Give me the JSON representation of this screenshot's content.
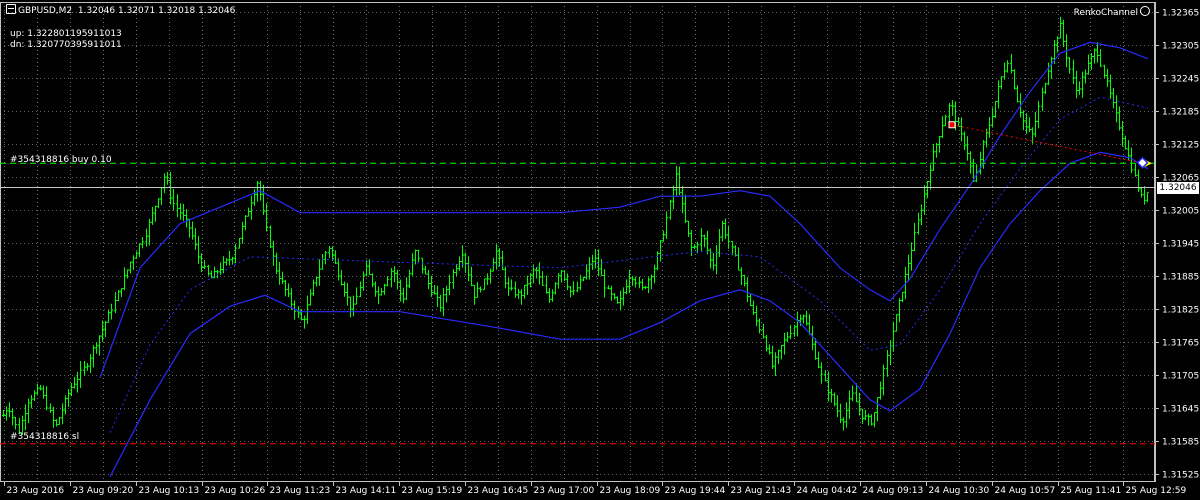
{
  "header": {
    "symbol": "GBPUSD,M2",
    "ohlc": "1.32046 1.32071 1.32018 1.32046"
  },
  "indicator": {
    "name": "RenkoChannel",
    "up_text": "up: 1.322801195911013",
    "dn_text": "dn: 1.320770395911011"
  },
  "order": {
    "label": "#354318816 buy 0.10",
    "price": 1.3209
  },
  "stop_loss": {
    "label": "#354318816 sl",
    "price": 1.3158
  },
  "current_price": {
    "label": "1.32046",
    "value": 1.32046
  },
  "colors": {
    "background": "#000000",
    "grid": "#c0c0c0",
    "bars": "#00ff00",
    "channel": "#2a2aff",
    "order_line": "#00ff00",
    "sl_line": "#ff0000",
    "axis_text": "#ffffff"
  },
  "chart_data": {
    "type": "ohlc",
    "y_ticks": [
      "1.32365",
      "1.32305",
      "1.32245",
      "1.32185",
      "1.32125",
      "1.32065",
      "1.32005",
      "1.31945",
      "1.31885",
      "1.31825",
      "1.31765",
      "1.31705",
      "1.31645",
      "1.31585",
      "1.31525"
    ],
    "ylim": [
      1.31525,
      1.32365
    ],
    "x_ticks": [
      "23 Aug 2016",
      "23 Aug 09:20",
      "23 Aug 10:13",
      "23 Aug 10:26",
      "23 Aug 11:23",
      "23 Aug 14:11",
      "23 Aug 15:19",
      "23 Aug 16:45",
      "23 Aug 17:00",
      "23 Aug 18:09",
      "23 Aug 19:44",
      "23 Aug 21:43",
      "24 Aug 04:42",
      "24 Aug 09:13",
      "24 Aug 10:30",
      "24 Aug 10:57",
      "25 Aug 11:41",
      "25 Aug 12:59"
    ],
    "grid": true,
    "price_path": [
      [
        0,
        1.3162
      ],
      [
        8,
        1.3165
      ],
      [
        18,
        1.316
      ],
      [
        28,
        1.3166
      ],
      [
        40,
        1.3168
      ],
      [
        55,
        1.3161
      ],
      [
        70,
        1.3168
      ],
      [
        85,
        1.3172
      ],
      [
        100,
        1.3178
      ],
      [
        115,
        1.3184
      ],
      [
        130,
        1.3191
      ],
      [
        145,
        1.3196
      ],
      [
        158,
        1.3203
      ],
      [
        165,
        1.3207
      ],
      [
        172,
        1.3202
      ],
      [
        180,
        1.32
      ],
      [
        190,
        1.3197
      ],
      [
        200,
        1.3191
      ],
      [
        210,
        1.3188
      ],
      [
        220,
        1.319
      ],
      [
        232,
        1.3192
      ],
      [
        245,
        1.3199
      ],
      [
        258,
        1.3206
      ],
      [
        265,
        1.3198
      ],
      [
        275,
        1.319
      ],
      [
        290,
        1.3184
      ],
      [
        302,
        1.318
      ],
      [
        315,
        1.3188
      ],
      [
        328,
        1.3194
      ],
      [
        340,
        1.3188
      ],
      [
        352,
        1.3182
      ],
      [
        365,
        1.319
      ],
      [
        378,
        1.3185
      ],
      [
        392,
        1.319
      ],
      [
        402,
        1.3184
      ],
      [
        415,
        1.3193
      ],
      [
        428,
        1.3187
      ],
      [
        440,
        1.3183
      ],
      [
        450,
        1.3188
      ],
      [
        462,
        1.3193
      ],
      [
        474,
        1.3185
      ],
      [
        486,
        1.3188
      ],
      [
        496,
        1.3193
      ],
      [
        508,
        1.3186
      ],
      [
        520,
        1.3185
      ],
      [
        535,
        1.319
      ],
      [
        548,
        1.3184
      ],
      [
        560,
        1.319
      ],
      [
        572,
        1.3185
      ],
      [
        582,
        1.3188
      ],
      [
        594,
        1.3192
      ],
      [
        606,
        1.3186
      ],
      [
        618,
        1.3183
      ],
      [
        630,
        1.3189
      ],
      [
        642,
        1.3186
      ],
      [
        654,
        1.319
      ],
      [
        664,
        1.3197
      ],
      [
        676,
        1.3207
      ],
      [
        684,
        1.3199
      ],
      [
        692,
        1.3193
      ],
      [
        702,
        1.3196
      ],
      [
        712,
        1.319
      ],
      [
        722,
        1.3198
      ],
      [
        732,
        1.3193
      ],
      [
        742,
        1.3188
      ],
      [
        752,
        1.3182
      ],
      [
        762,
        1.3178
      ],
      [
        772,
        1.3172
      ],
      [
        782,
        1.3176
      ],
      [
        792,
        1.3179
      ],
      [
        802,
        1.3182
      ],
      [
        812,
        1.3176
      ],
      [
        822,
        1.317
      ],
      [
        832,
        1.3166
      ],
      [
        842,
        1.3162
      ],
      [
        852,
        1.3167
      ],
      [
        862,
        1.3163
      ],
      [
        872,
        1.3162
      ],
      [
        882,
        1.317
      ],
      [
        892,
        1.3178
      ],
      [
        902,
        1.3186
      ],
      [
        912,
        1.3194
      ],
      [
        922,
        1.3202
      ],
      [
        932,
        1.321
      ],
      [
        942,
        1.3216
      ],
      [
        950,
        1.322
      ],
      [
        958,
        1.3215
      ],
      [
        966,
        1.3212
      ],
      [
        974,
        1.3205
      ],
      [
        982,
        1.3212
      ],
      [
        992,
        1.3218
      ],
      [
        1000,
        1.3224
      ],
      [
        1008,
        1.3228
      ],
      [
        1016,
        1.3221
      ],
      [
        1024,
        1.3216
      ],
      [
        1032,
        1.3214
      ],
      [
        1042,
        1.3222
      ],
      [
        1050,
        1.3228
      ],
      [
        1060,
        1.3234
      ],
      [
        1068,
        1.3227
      ],
      [
        1076,
        1.3222
      ],
      [
        1086,
        1.3226
      ],
      [
        1096,
        1.323
      ],
      [
        1104,
        1.3225
      ],
      [
        1112,
        1.322
      ],
      [
        1122,
        1.3214
      ],
      [
        1132,
        1.3208
      ],
      [
        1142,
        1.3202
      ],
      [
        1150,
        1.3205
      ]
    ],
    "channel_upper": [
      [
        100,
        1.317
      ],
      [
        140,
        1.319
      ],
      [
        180,
        1.3198
      ],
      [
        220,
        1.3201
      ],
      [
        260,
        1.3204
      ],
      [
        300,
        1.32
      ],
      [
        400,
        1.32
      ],
      [
        500,
        1.32
      ],
      [
        560,
        1.32
      ],
      [
        620,
        1.3201
      ],
      [
        660,
        1.3203
      ],
      [
        700,
        1.3203
      ],
      [
        740,
        1.3204
      ],
      [
        770,
        1.3203
      ],
      [
        800,
        1.3198
      ],
      [
        840,
        1.319
      ],
      [
        870,
        1.3186
      ],
      [
        890,
        1.3184
      ],
      [
        910,
        1.3188
      ],
      [
        940,
        1.3197
      ],
      [
        970,
        1.3205
      ],
      [
        1000,
        1.3214
      ],
      [
        1030,
        1.3222
      ],
      [
        1060,
        1.3229
      ],
      [
        1090,
        1.3231
      ],
      [
        1120,
        1.323
      ],
      [
        1148,
        1.3228
      ]
    ],
    "channel_lower": [
      [
        110,
        1.3152
      ],
      [
        150,
        1.3166
      ],
      [
        190,
        1.3178
      ],
      [
        230,
        1.3183
      ],
      [
        265,
        1.3185
      ],
      [
        300,
        1.3182
      ],
      [
        400,
        1.3182
      ],
      [
        500,
        1.3179
      ],
      [
        560,
        1.3177
      ],
      [
        620,
        1.3177
      ],
      [
        660,
        1.318
      ],
      [
        700,
        1.3184
      ],
      [
        740,
        1.3186
      ],
      [
        770,
        1.3184
      ],
      [
        800,
        1.318
      ],
      [
        840,
        1.3172
      ],
      [
        870,
        1.3166
      ],
      [
        890,
        1.3164
      ],
      [
        920,
        1.3168
      ],
      [
        950,
        1.3178
      ],
      [
        980,
        1.319
      ],
      [
        1010,
        1.3198
      ],
      [
        1040,
        1.3204
      ],
      [
        1070,
        1.3209
      ],
      [
        1100,
        1.3211
      ],
      [
        1130,
        1.321
      ],
      [
        1148,
        1.3208
      ]
    ],
    "channel_mid": [
      [
        110,
        1.316
      ],
      [
        150,
        1.3176
      ],
      [
        190,
        1.3186
      ],
      [
        250,
        1.3192
      ],
      [
        400,
        1.3191
      ],
      [
        560,
        1.319
      ],
      [
        700,
        1.3193
      ],
      [
        760,
        1.3192
      ],
      [
        820,
        1.3184
      ],
      [
        870,
        1.3175
      ],
      [
        900,
        1.3176
      ],
      [
        940,
        1.3186
      ],
      [
        980,
        1.3198
      ],
      [
        1020,
        1.3208
      ],
      [
        1060,
        1.3217
      ],
      [
        1100,
        1.3221
      ],
      [
        1148,
        1.3219
      ]
    ]
  }
}
